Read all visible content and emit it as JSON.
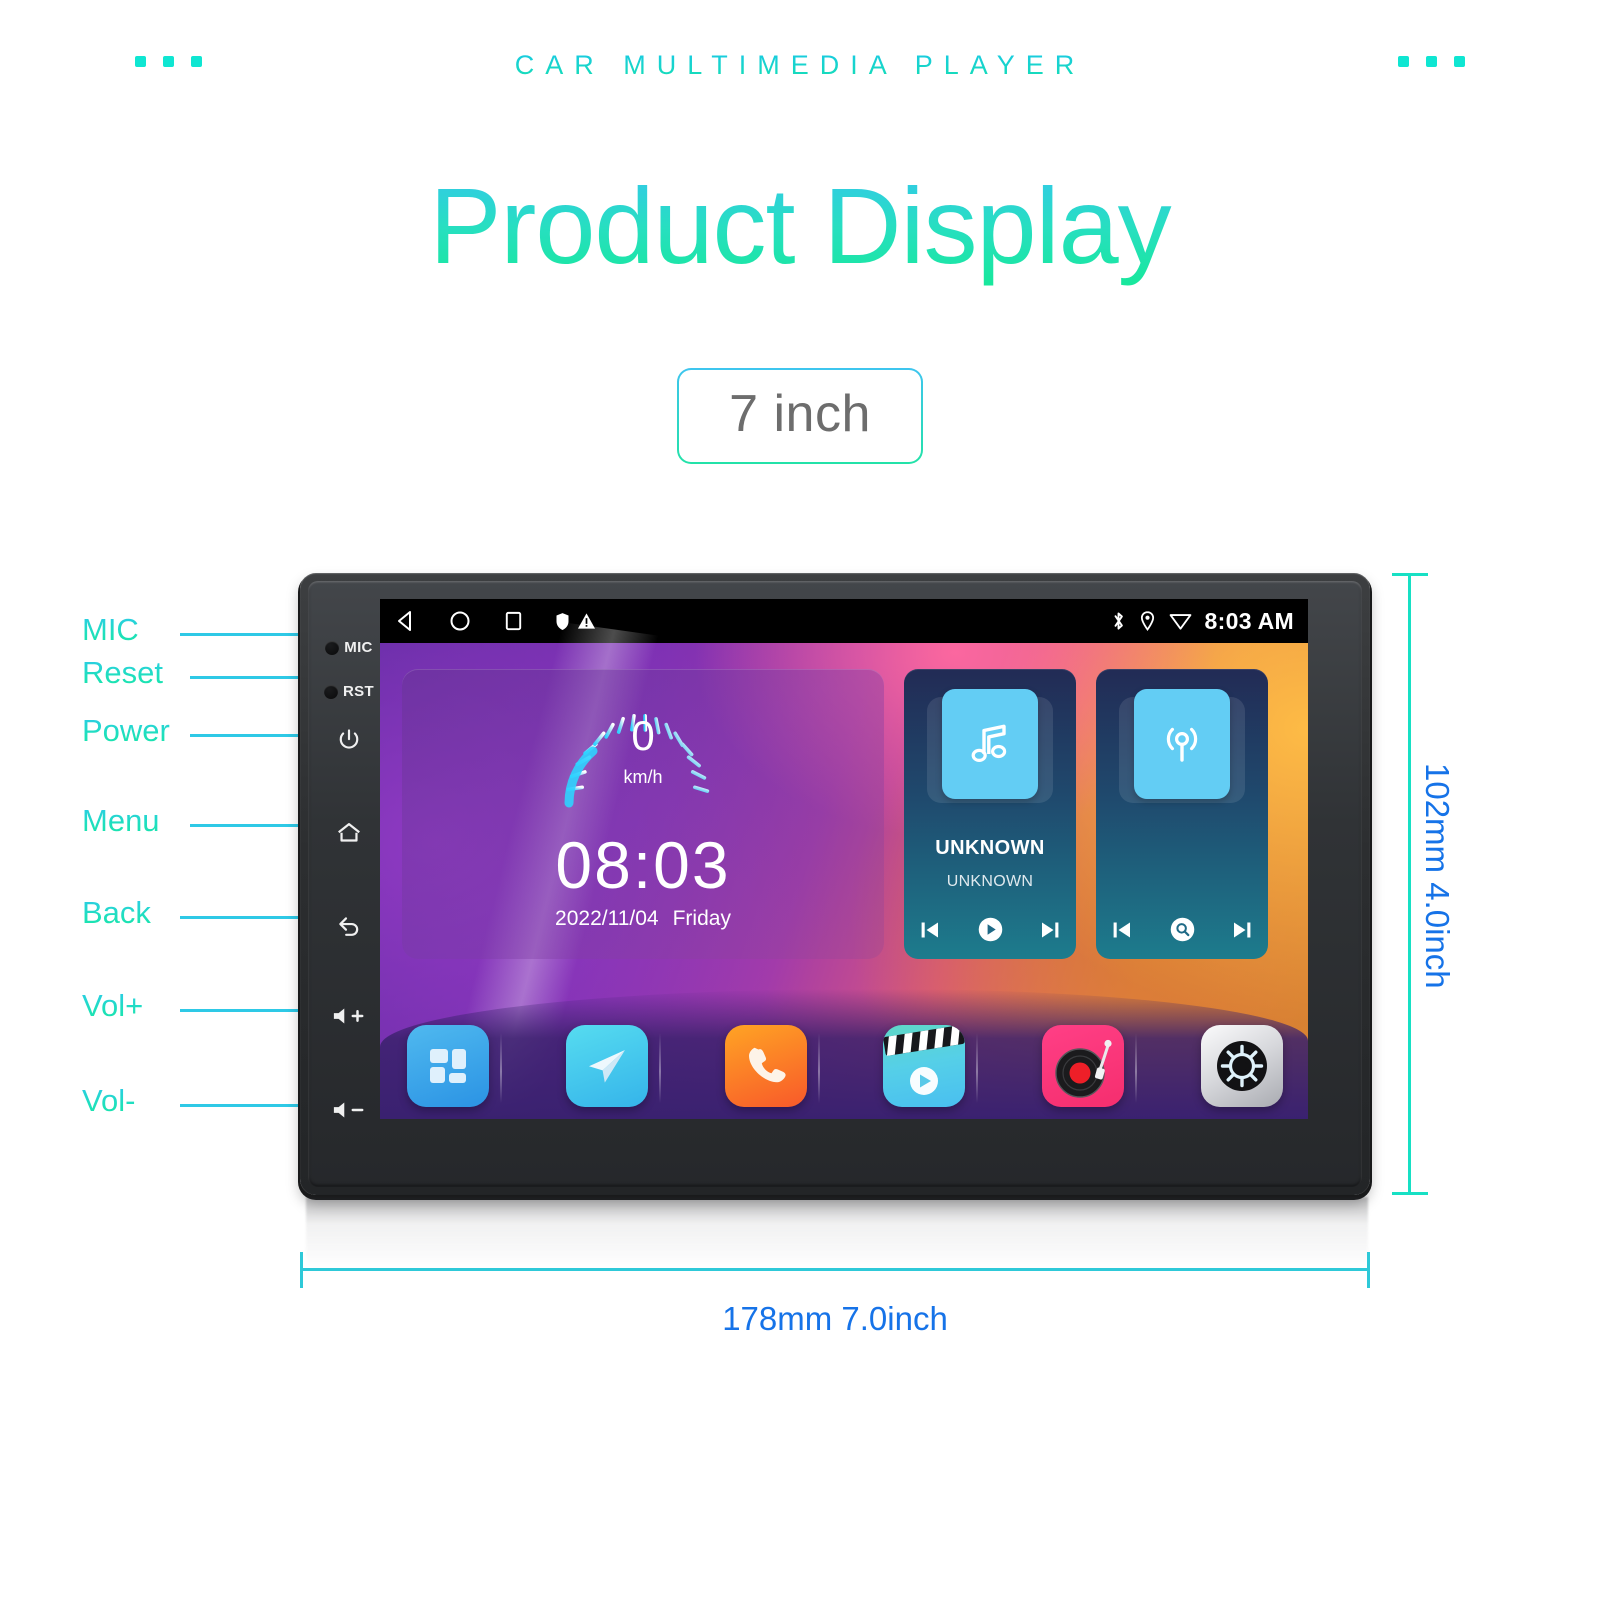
{
  "header": {
    "kicker": "CAR MULTIMEDIA PLAYER",
    "title": "Product Display",
    "badge": "7 inch"
  },
  "callouts": [
    {
      "label": "MIC"
    },
    {
      "label": "Reset"
    },
    {
      "label": "Power"
    },
    {
      "label": "Menu"
    },
    {
      "label": "Back"
    },
    {
      "label": "Vol+"
    },
    {
      "label": "Vol-"
    }
  ],
  "bezel": {
    "mic_text": "MIC",
    "rst_text": "RST"
  },
  "screen": {
    "statusbar": {
      "time": "8:03 AM",
      "left_icons": [
        "back-triangle-icon",
        "home-circle-icon",
        "recents-square-icon",
        "shield-icon",
        "warning-icon"
      ],
      "right_icons": [
        "bluetooth-icon",
        "location-pin-icon",
        "wifi-icon"
      ]
    },
    "clock_widget": {
      "speed_value": "0",
      "speed_unit": "km/h",
      "time": "08:03",
      "date": "2022/11/04",
      "weekday": "Friday"
    },
    "music_widget": {
      "icon": "music-note-icon",
      "title": "UNKNOWN",
      "subtitle": "UNKNOWN",
      "controls": [
        "previous-icon",
        "play-icon",
        "next-icon"
      ]
    },
    "radio_widget": {
      "icon": "radio-broadcast-icon",
      "controls": [
        "previous-icon",
        "search-icon",
        "next-icon"
      ]
    },
    "dock": [
      {
        "name": "apps-grid-icon"
      },
      {
        "name": "navigation-icon"
      },
      {
        "name": "phone-icon"
      },
      {
        "name": "video-icon"
      },
      {
        "name": "music-player-icon"
      },
      {
        "name": "settings-gear-icon"
      }
    ]
  },
  "dimensions": {
    "height": "102mm 4.0inch",
    "width": "178mm 7.0inch"
  },
  "colors": {
    "accent_cyan": "#1ad9cf",
    "accent_blue": "#1673e8",
    "accent_green": "#17e89a"
  }
}
